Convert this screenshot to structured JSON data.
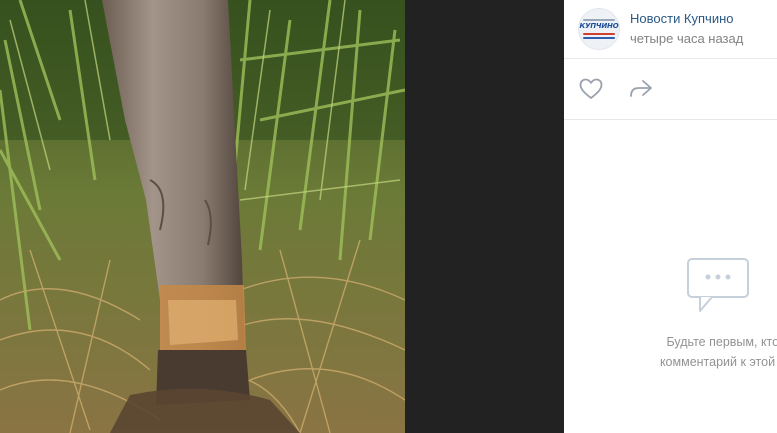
{
  "post": {
    "author": "Новости Купчино",
    "time": "четыре часа назад",
    "avatar_text": "КУПЧИНО"
  },
  "actions": {
    "like_icon": "heart-icon",
    "share_icon": "share-arrow-icon"
  },
  "comments": {
    "empty_icon": "comments-bubble-icon",
    "empty_line1": "Будьте первым, кто ост",
    "empty_line2": "комментарий к этой фото"
  },
  "colors": {
    "link": "#2a5885",
    "muted": "#828282",
    "icon": "#99a2ad",
    "empty_icon": "#c5d0db",
    "viewer_bg": "#222222"
  }
}
